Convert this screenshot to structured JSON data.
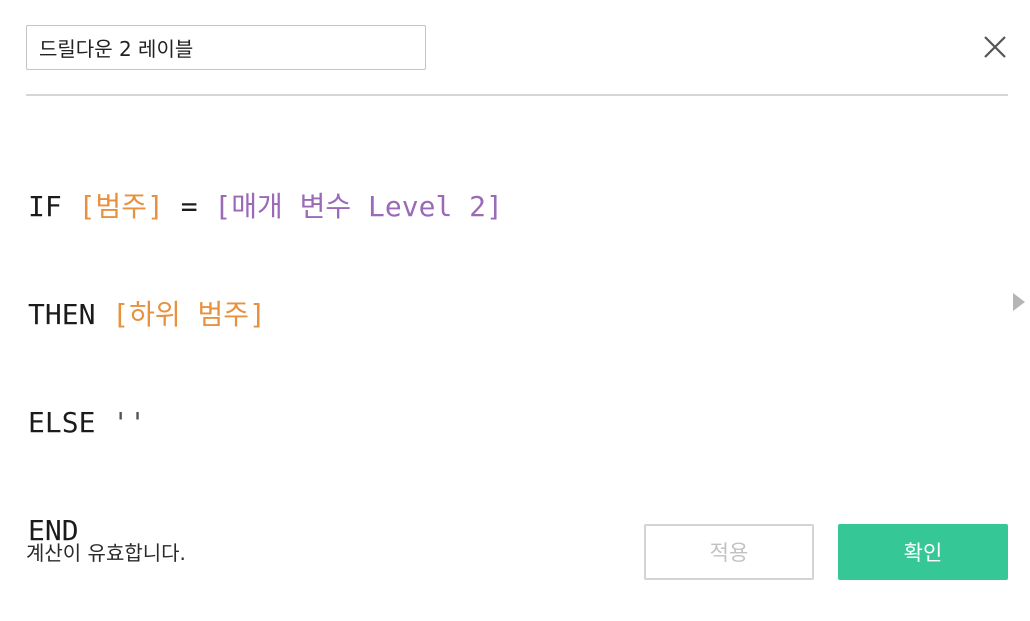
{
  "calc_name": "드릴다운 2 레이블",
  "formula": {
    "line1": {
      "kw_if": "IF",
      "field_category": "[범주]",
      "op_eq": "=",
      "param_level": "[매개 변수 Level 2]"
    },
    "line2": {
      "kw_then": "THEN",
      "field_subcategory": "[하위 범주]"
    },
    "line3": {
      "kw_else": "ELSE",
      "empty_string": "''"
    },
    "line4": {
      "kw_end": "END"
    }
  },
  "status": "계산이 유효합니다.",
  "buttons": {
    "apply": "적용",
    "ok": "확인"
  },
  "colors": {
    "field": "#e8913e",
    "parameter": "#9a6ab9",
    "ok_button": "#35c896",
    "apply_text_disabled": "#c2c2c2"
  },
  "icons": {
    "close": "close-icon",
    "expand": "expand-right-arrow-icon"
  }
}
